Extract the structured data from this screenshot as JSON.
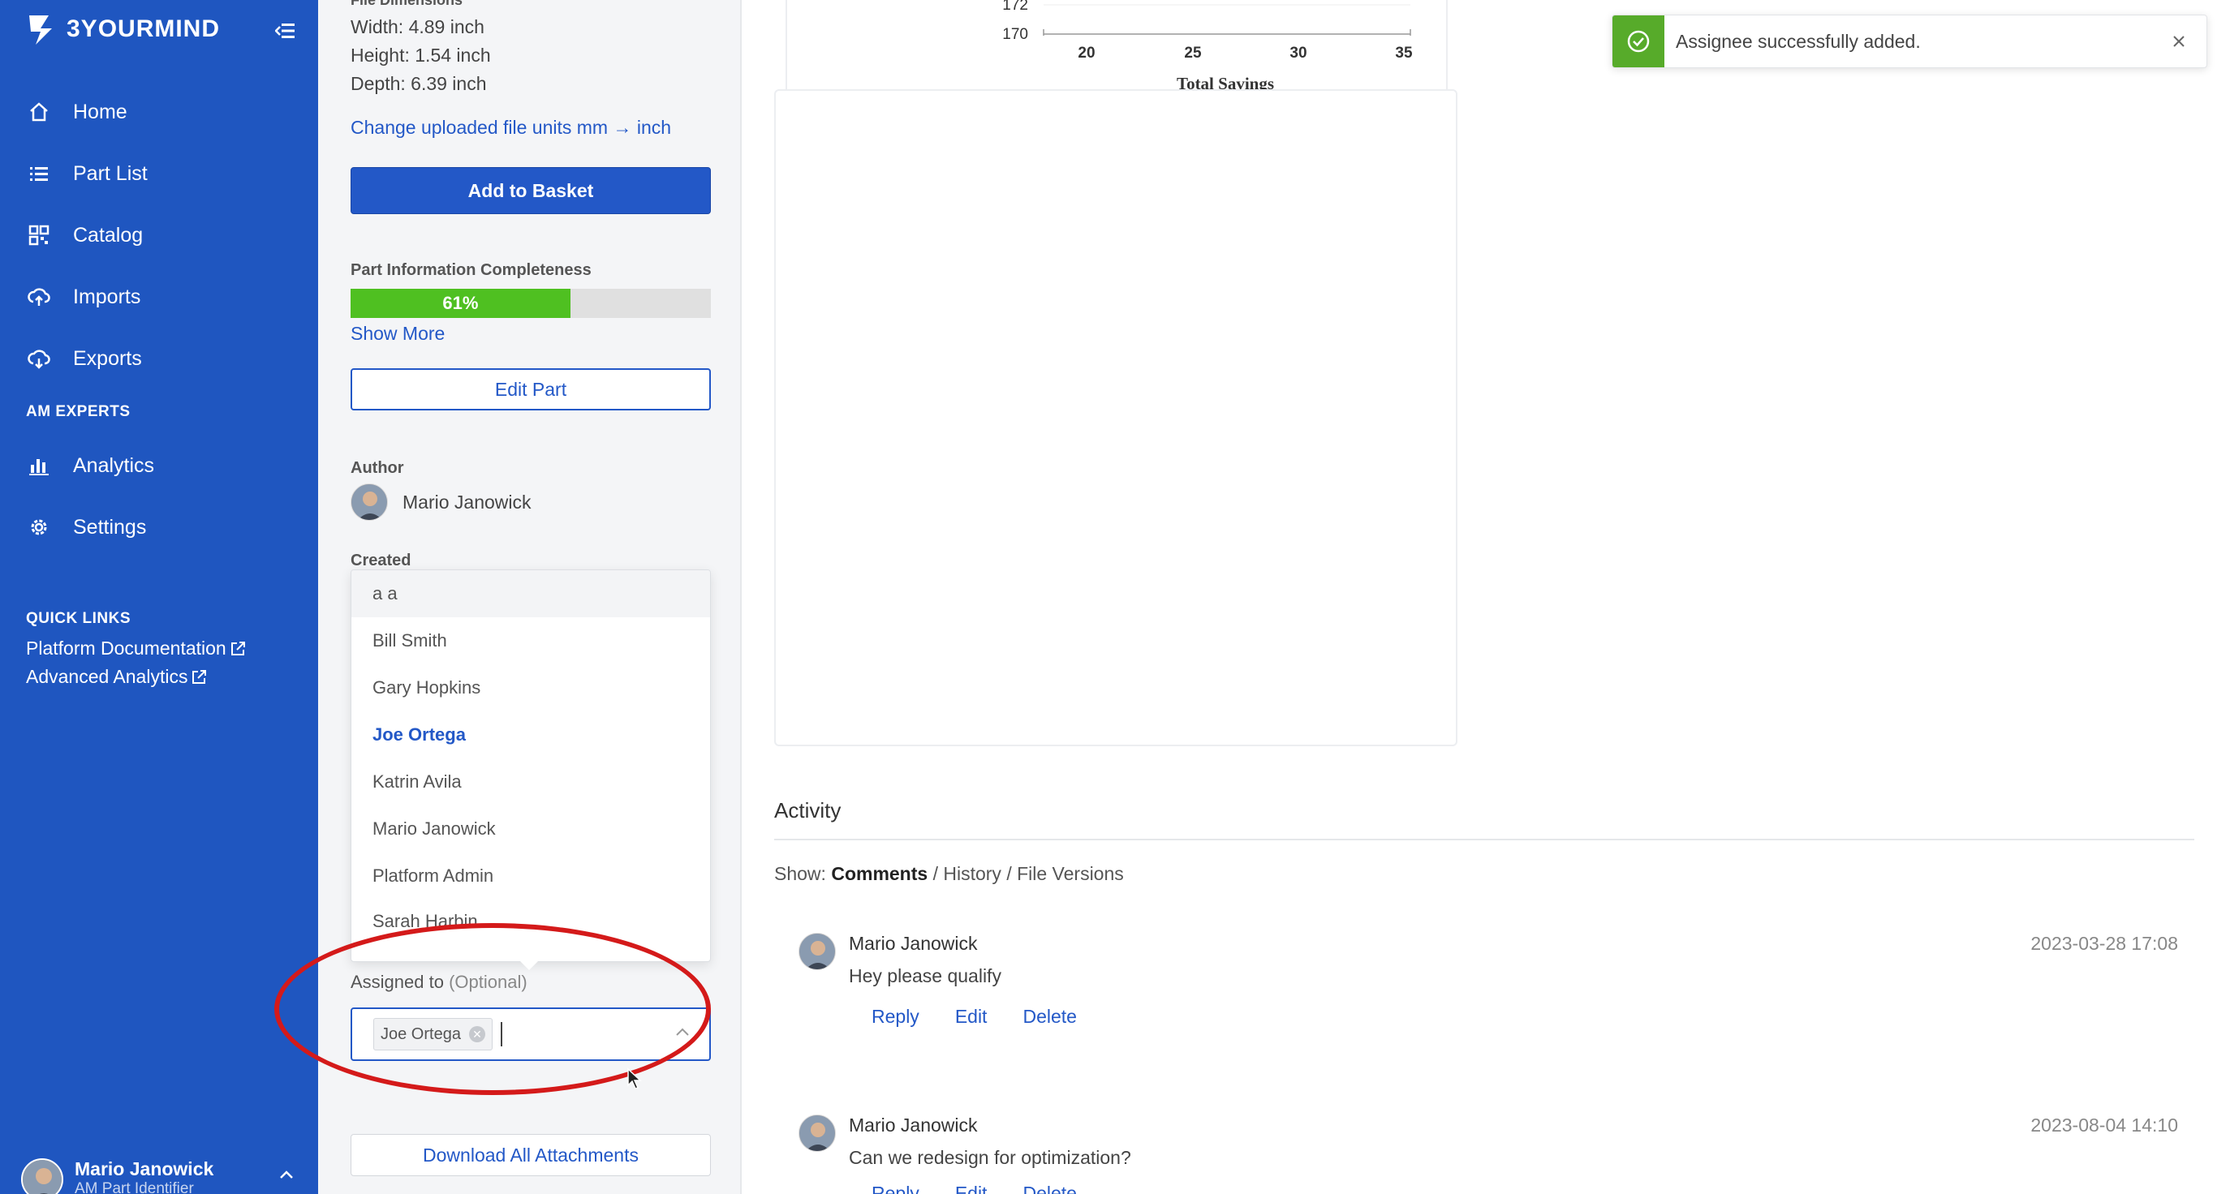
{
  "sidebar": {
    "brand": "3YOURMIND",
    "nav": [
      {
        "label": "Home",
        "icon": "home-icon"
      },
      {
        "label": "Part List",
        "icon": "list-icon"
      },
      {
        "label": "Catalog",
        "icon": "catalog-icon"
      },
      {
        "label": "Imports",
        "icon": "cloud-upload-icon"
      },
      {
        "label": "Exports",
        "icon": "cloud-download-icon"
      }
    ],
    "section_am": "AM EXPERTS",
    "nav_am": [
      {
        "label": "Analytics",
        "icon": "analytics-icon"
      },
      {
        "label": "Settings",
        "icon": "gear-icon"
      }
    ],
    "quick_links_title": "QUICK LINKS",
    "quick_links": [
      "Platform Documentation",
      "Advanced Analytics"
    ],
    "user": {
      "name": "Mario Janowick",
      "role": "AM Part Identifier"
    }
  },
  "part_panel": {
    "dimensions_label": "File Dimensions",
    "width": "Width: 4.89 inch",
    "height": "Height: 1.54 inch",
    "depth": "Depth: 6.39 inch",
    "change_units_link": "Change uploaded file units mm → inch",
    "add_to_basket": "Add to Basket",
    "completeness_label": "Part Information Completeness",
    "completeness_value": 61,
    "completeness_text": "61%",
    "show_more": "Show More",
    "edit_part": "Edit Part",
    "author_label": "Author",
    "author_name": "Mario Janowick",
    "created_label": "Created",
    "assignee_options": [
      "a a",
      "Bill Smith",
      "Gary Hopkins",
      "Joe Ortega",
      "Katrin Avila",
      "Mario Janowick",
      "Platform Admin",
      "Sarah Harbin"
    ],
    "selected_option": "Joe Ortega",
    "assigned_label": "Assigned to",
    "assigned_optional": "(Optional)",
    "assigned_tag": "Joe Ortega",
    "download_all": "Download All Attachments"
  },
  "chart": {
    "y_ticks": [
      "172",
      "170"
    ],
    "x_ticks": [
      "20",
      "25",
      "30",
      "35"
    ],
    "x_label": "Total Savings"
  },
  "activity": {
    "title": "Activity",
    "show_prefix": "Show:",
    "show_options": [
      "Comments",
      "History",
      "File Versions"
    ],
    "comments": [
      {
        "author": "Mario Janowick",
        "text": "Hey please qualify",
        "date": "2023-03-28 17:08",
        "actions": [
          "Reply",
          "Edit",
          "Delete"
        ]
      },
      {
        "author": "Mario Janowick",
        "text": "Can we redesign for optimization?",
        "date": "2023-08-04 14:10",
        "actions": [
          "Reply",
          "Edit",
          "Delete"
        ]
      }
    ]
  },
  "toast": {
    "message": "Assignee successfully added."
  },
  "colors": {
    "sidebar": "#1f56c0",
    "primary": "#2358c7",
    "progress": "#4fc021",
    "success": "#57ab2a",
    "annotation": "#d41a1a"
  }
}
